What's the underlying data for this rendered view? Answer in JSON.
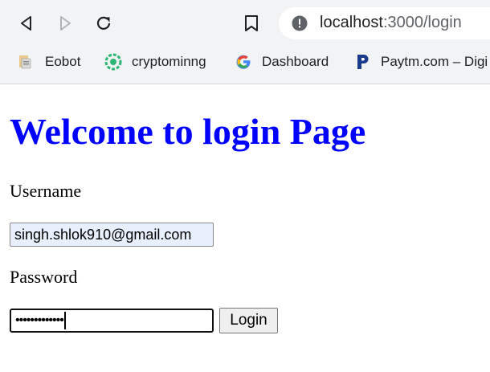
{
  "browser": {
    "url_host": "localhost",
    "url_rest": ":3000/login",
    "bookmarks": [
      {
        "label": "Eobot",
        "icon": "eobot-icon"
      },
      {
        "label": "cryptominng",
        "icon": "cryptominng-icon"
      },
      {
        "label": "Dashboard",
        "icon": "google-icon"
      },
      {
        "label": "Paytm.com – Digi",
        "icon": "paytm-icon"
      }
    ]
  },
  "page": {
    "title": "Welcome to login Page",
    "username_label": "Username",
    "username_value": "singh.shlok910@gmail.com",
    "password_label": "Password",
    "password_mask": "•••••••••••••",
    "login_label": "Login"
  },
  "colors": {
    "heading": "#0000ff",
    "chrome": "#f1f3f4",
    "autofill": "#e8f0fe"
  }
}
